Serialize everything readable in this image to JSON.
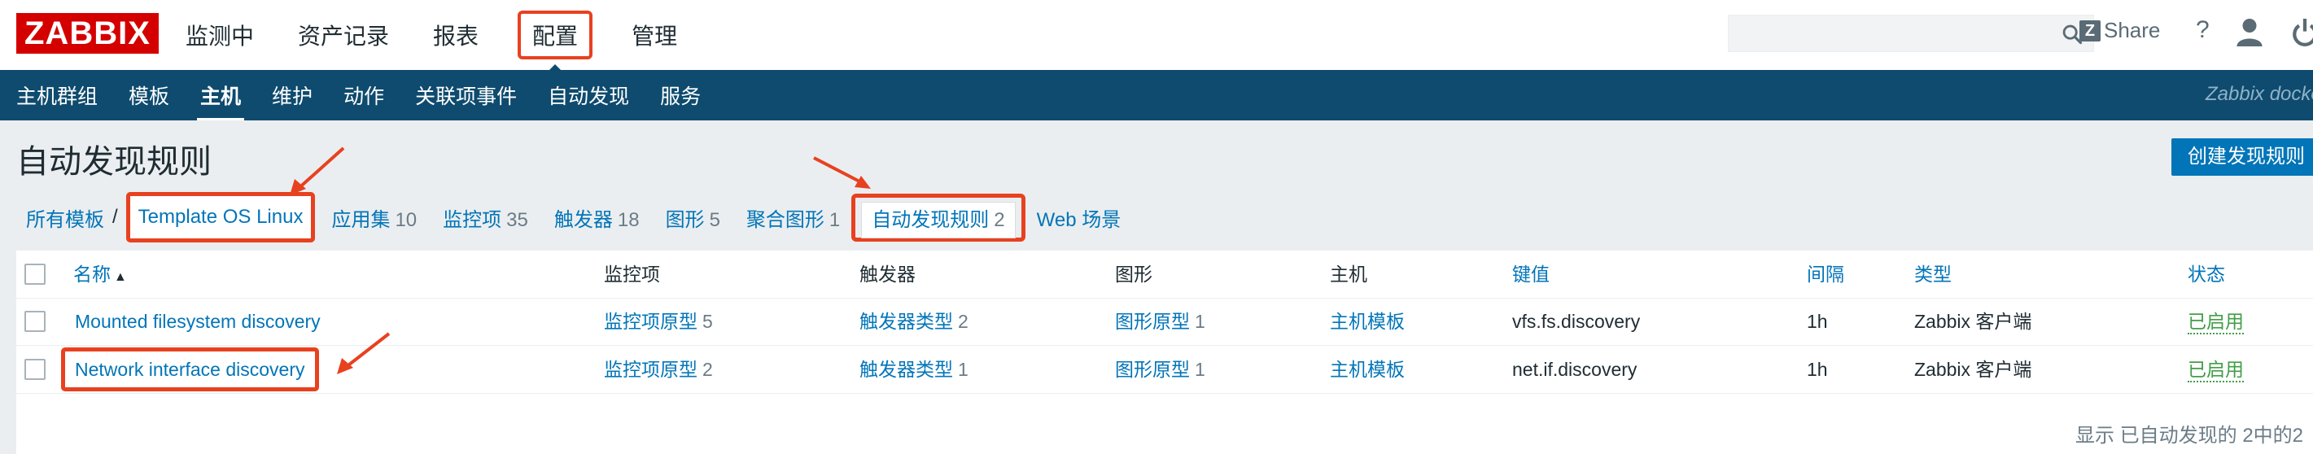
{
  "brand": {
    "logo_text": "ZABBIX",
    "color": "#d40000"
  },
  "topnav": {
    "items": [
      {
        "label": "监测中"
      },
      {
        "label": "资产记录"
      },
      {
        "label": "报表"
      },
      {
        "label": "配置"
      },
      {
        "label": "管理"
      }
    ],
    "active_index": 3
  },
  "topright": {
    "search": {
      "placeholder": "",
      "value": ""
    },
    "share_label": "Share",
    "share_icon_letter": "Z",
    "help_label": "?"
  },
  "subnav": {
    "items": [
      {
        "label": "主机群组"
      },
      {
        "label": "模板"
      },
      {
        "label": "主机"
      },
      {
        "label": "维护"
      },
      {
        "label": "动作"
      },
      {
        "label": "关联项事件"
      },
      {
        "label": "自动发现"
      },
      {
        "label": "服务"
      }
    ],
    "active_index": 2,
    "server_name": "Zabbix docke"
  },
  "page": {
    "title": "自动发现规则",
    "create_button": "创建发现规则"
  },
  "breadcrumb": {
    "root": "所有模板",
    "separator": "/",
    "template": "Template OS Linux"
  },
  "tabs": [
    {
      "label": "应用集",
      "count": "10"
    },
    {
      "label": "监控项",
      "count": "35"
    },
    {
      "label": "触发器",
      "count": "18"
    },
    {
      "label": "图形",
      "count": "5"
    },
    {
      "label": "聚合图形",
      "count": "1"
    }
  ],
  "active_tab": {
    "label": "自动发现规则",
    "count": "2"
  },
  "last_tab": {
    "label": "Web 场景"
  },
  "table": {
    "columns": {
      "name": "名称",
      "sort_indicator": "▲",
      "items": "监控项",
      "triggers": "触发器",
      "graphs": "图形",
      "hosts": "主机",
      "key": "键值",
      "interval": "间隔",
      "type": "类型",
      "status": "状态"
    },
    "rows": [
      {
        "name": "Mounted filesystem discovery",
        "items_label": "监控项原型",
        "items_count": "5",
        "triggers_label": "触发器类型",
        "triggers_count": "2",
        "graphs_label": "图形原型",
        "graphs_count": "1",
        "hosts_label": "主机模板",
        "key": "vfs.fs.discovery",
        "interval": "1h",
        "type": "Zabbix 客户端",
        "status": "已启用"
      },
      {
        "name": "Network interface discovery",
        "items_label": "监控项原型",
        "items_count": "2",
        "triggers_label": "触发器类型",
        "triggers_count": "1",
        "graphs_label": "图形原型",
        "graphs_count": "1",
        "hosts_label": "主机模板",
        "key": "net.if.discovery",
        "interval": "1h",
        "type": "Zabbix 客户端",
        "status": "已启用"
      }
    ],
    "footer": "显示 已自动发现的 2中的2"
  },
  "colors": {
    "header_bg": "#ffffff",
    "subnav_bg": "#0e4b6e",
    "link": "#0275b8",
    "status_enabled": "#429e47",
    "annotation": "#e8411f",
    "page_bg": "#ebeef0"
  }
}
